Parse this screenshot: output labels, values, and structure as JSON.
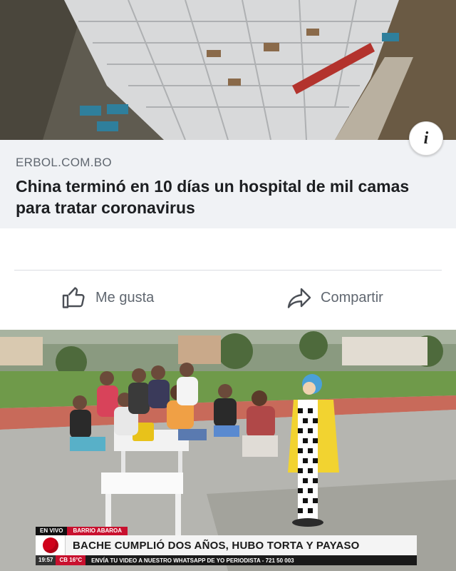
{
  "top_photo": {
    "info_button_glyph": "i"
  },
  "link_preview": {
    "source": "ERBOL.COM.BO",
    "headline": "China terminó en 10 días un hospital de mil camas para tratar coronavirus"
  },
  "actions": {
    "like_label": "Me gusta",
    "like_icon": "thumbs-up-icon",
    "share_label": "Compartir",
    "share_icon": "share-arrow-icon"
  },
  "news_broadcast": {
    "live_tag": "EN VIVO",
    "topic_tag": "BARRIO ABAROA",
    "headline": "BACHE CUMPLIÓ DOS AÑOS, HUBO TORTA Y PAYASO",
    "clock": "19:57",
    "weather": "CB 16°C",
    "ticker": "ENVÍA TU VIDEO A NUESTRO WHATSAPP DE YO PERIODISTA - 721 50 003"
  },
  "colors": {
    "card_background": "#f0f2f5",
    "text_primary": "#1c1e21",
    "text_secondary": "#606770",
    "tv_red": "#c8102e"
  }
}
